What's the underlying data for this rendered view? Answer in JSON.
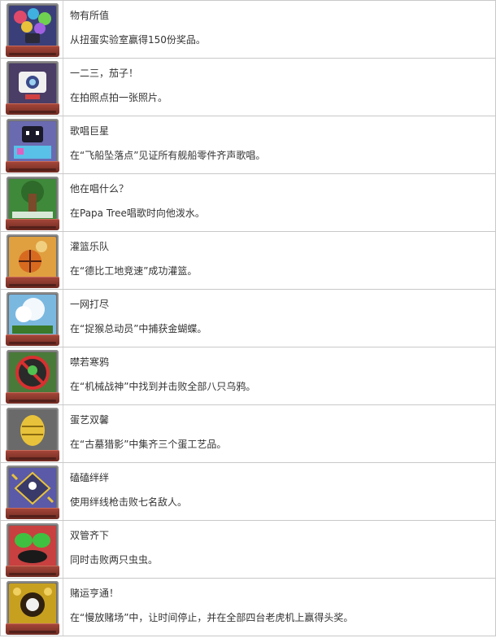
{
  "achievements": [
    {
      "icon": "capsule-machine-icon",
      "title": "物有所值",
      "description": "从扭蛋实验室赢得150份奖品。",
      "art_bg": "#3a3f7a",
      "art_accent": "#e8c23a"
    },
    {
      "icon": "camera-robot-icon",
      "title": "一二三，茄子！",
      "description": "在拍照点拍一张照片。",
      "art_bg": "#4a3d66",
      "art_accent": "#f0f0f0"
    },
    {
      "icon": "singing-robot-icon",
      "title": "歌唱巨星",
      "description": "在“飞船坠落点”见证所有舰船零件齐声歌唱。",
      "art_bg": "#6a6ab0",
      "art_accent": "#59c0e8"
    },
    {
      "icon": "tree-icon",
      "title": "他在唱什么？",
      "description": "在Papa Tree唱歌时向他泼水。",
      "art_bg": "#3e8a3a",
      "art_accent": "#7a4a2a"
    },
    {
      "icon": "basketball-icon",
      "title": "灌篮乐队",
      "description": "在“德比工地竞速”成功灌篮。",
      "art_bg": "#e0a040",
      "art_accent": "#d86a20"
    },
    {
      "icon": "net-icon",
      "title": "一网打尽",
      "description": "在“捉猴总动员”中捕获金蝴蝶。",
      "art_bg": "#7ab8e0",
      "art_accent": "#ffffff"
    },
    {
      "icon": "no-bird-icon",
      "title": "噤若寒鸦",
      "description": "在“机械战神”中找到并击败全部八只乌鸦。",
      "art_bg": "#4a7a3a",
      "art_accent": "#d83030"
    },
    {
      "icon": "golden-egg-icon",
      "title": "蛋艺双馨",
      "description": "在“古墓猎影”中集齐三个蛋工艺品。",
      "art_bg": "#6a6a6a",
      "art_accent": "#e8c23a"
    },
    {
      "icon": "tripwire-icon",
      "title": "磕磕绊绊",
      "description": "使用绊线枪击败七名敌人。",
      "art_bg": "#5a5aa8",
      "art_accent": "#e8c23a"
    },
    {
      "icon": "twin-frogs-icon",
      "title": "双管齐下",
      "description": "同时击败两只虫虫。",
      "art_bg": "#c84040",
      "art_accent": "#40c040"
    },
    {
      "icon": "slot-machine-icon",
      "title": "赌运亨通！",
      "description": "在“慢放赌场”中，让时间停止，并在全部四台老虎机上赢得头奖。",
      "art_bg": "#c8a020",
      "art_accent": "#302010"
    }
  ]
}
